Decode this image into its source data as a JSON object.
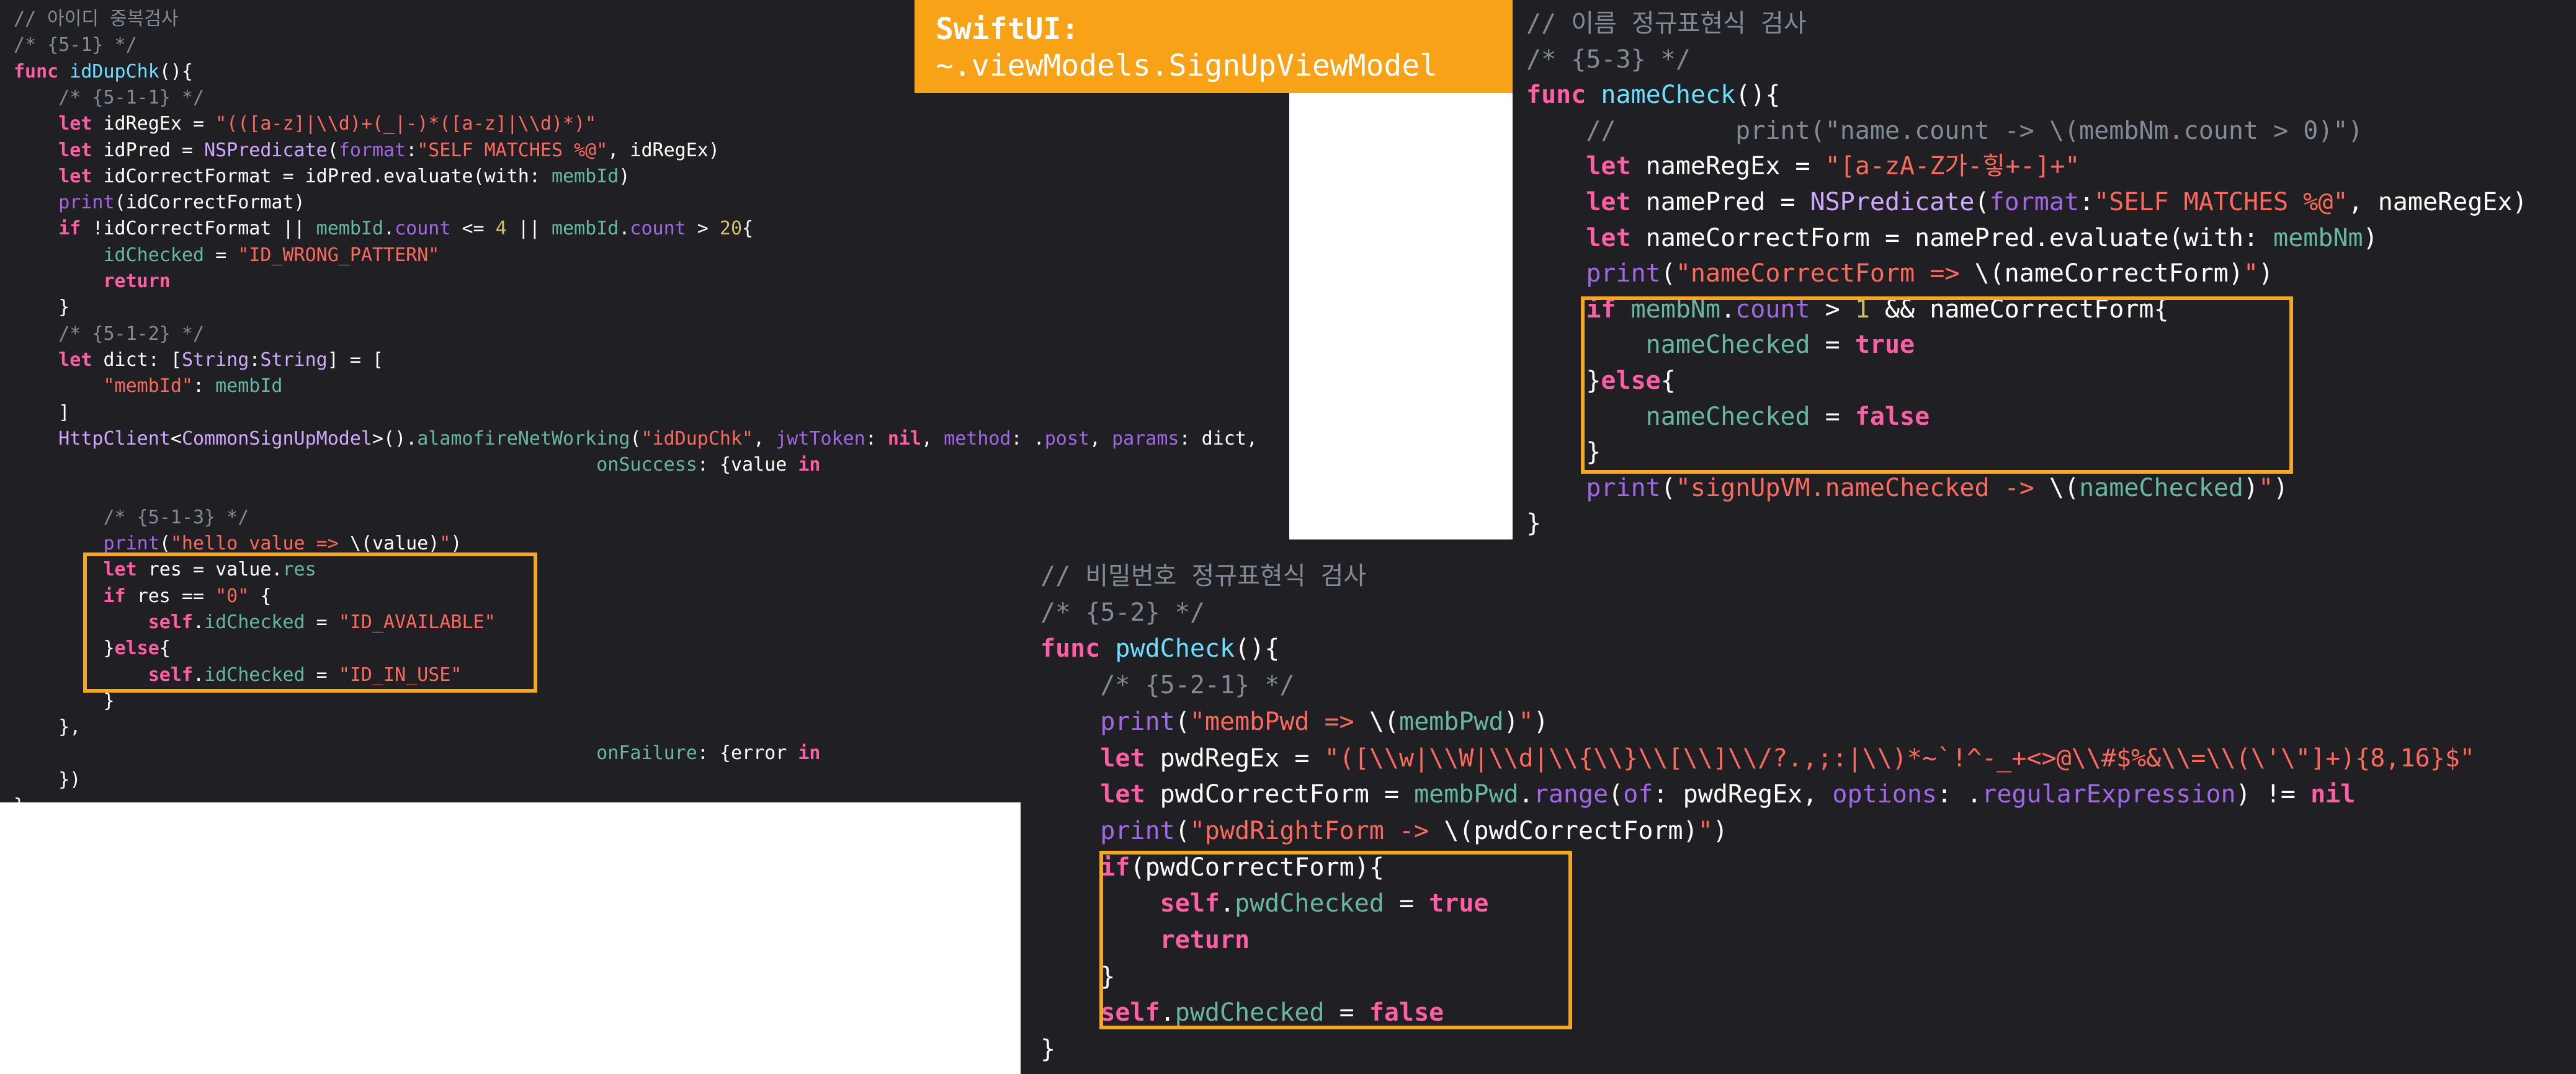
{
  "banner": {
    "line1": "SwiftUI:",
    "line2": "~.viewModels.SignUpViewModel"
  },
  "colors": {
    "background": "#1f1f24",
    "highlight_box": "#f5a623",
    "banner": "#f7a217",
    "comment": "#7f8c98",
    "keyword": "#fc5fa3",
    "string": "#fc6a5d",
    "number": "#d0bf69"
  },
  "panels": {
    "id_check": {
      "lines": [
        [
          [
            "c-comment",
            "// 아이디 중복검사"
          ]
        ],
        [
          [
            "c-comment",
            "/* {5-1} */"
          ]
        ],
        [
          [
            "c-kw",
            "func "
          ],
          [
            "c-call",
            "idDupChk"
          ],
          [
            "c-plain",
            "(){"
          ]
        ],
        [
          [
            "c-plain",
            "    "
          ],
          [
            "c-comment",
            "/* {5-1-1} */"
          ]
        ],
        [
          [
            "c-plain",
            "    "
          ],
          [
            "c-kw",
            "let "
          ],
          [
            "c-plain",
            "idRegEx = "
          ],
          [
            "c-str",
            "\"(([a-z]|\\\\d)+(_|-)*([a-z]|\\\\d)*)\""
          ]
        ],
        [
          [
            "c-plain",
            "    "
          ],
          [
            "c-kw",
            "let "
          ],
          [
            "c-plain",
            "idPred = "
          ],
          [
            "c-type",
            "NSPredicate"
          ],
          [
            "c-plain",
            "("
          ],
          [
            "c-prop",
            "format"
          ],
          [
            "c-plain",
            ":"
          ],
          [
            "c-str",
            "\"SELF MATCHES %@\""
          ],
          [
            "c-plain",
            ", idRegEx)"
          ]
        ],
        [
          [
            "c-plain",
            "    "
          ],
          [
            "c-kw",
            "let "
          ],
          [
            "c-plain",
            "idCorrectFormat = idPred.evaluate(with: "
          ],
          [
            "c-fn",
            "membId"
          ],
          [
            "c-plain",
            ")"
          ]
        ],
        [
          [
            "c-plain",
            "    "
          ],
          [
            "c-prop",
            "print"
          ],
          [
            "c-plain",
            "(idCorrectFormat)"
          ]
        ],
        [
          [
            "c-plain",
            "    "
          ],
          [
            "c-kw",
            "if "
          ],
          [
            "c-plain",
            "!idCorrectFormat || "
          ],
          [
            "c-fn",
            "membId"
          ],
          [
            "c-plain",
            "."
          ],
          [
            "c-prop",
            "count"
          ],
          [
            "c-plain",
            " <= "
          ],
          [
            "c-num",
            "4"
          ],
          [
            "c-plain",
            " || "
          ],
          [
            "c-fn",
            "membId"
          ],
          [
            "c-plain",
            "."
          ],
          [
            "c-prop",
            "count"
          ],
          [
            "c-plain",
            " > "
          ],
          [
            "c-num",
            "20"
          ],
          [
            "c-plain",
            "{"
          ]
        ],
        [
          [
            "c-plain",
            "        "
          ],
          [
            "c-fn",
            "idChecked"
          ],
          [
            "c-plain",
            " = "
          ],
          [
            "c-str",
            "\"ID_WRONG_PATTERN\""
          ]
        ],
        [
          [
            "c-plain",
            "        "
          ],
          [
            "c-kw",
            "return"
          ]
        ],
        [
          [
            "c-plain",
            "    }"
          ]
        ],
        [
          [
            "c-plain",
            "    "
          ],
          [
            "c-comment",
            "/* {5-1-2} */"
          ]
        ],
        [
          [
            "c-plain",
            "    "
          ],
          [
            "c-kw",
            "let "
          ],
          [
            "c-plain",
            "dict: ["
          ],
          [
            "c-type",
            "String"
          ],
          [
            "c-plain",
            ":"
          ],
          [
            "c-type",
            "String"
          ],
          [
            "c-plain",
            "] = ["
          ]
        ],
        [
          [
            "c-plain",
            "        "
          ],
          [
            "c-str",
            "\"membId\""
          ],
          [
            "c-plain",
            ": "
          ],
          [
            "c-fn",
            "membId"
          ]
        ],
        [
          [
            "c-plain",
            "    ]"
          ]
        ],
        [
          [
            "c-plain",
            "    "
          ],
          [
            "c-type",
            "HttpClient"
          ],
          [
            "c-plain",
            "<"
          ],
          [
            "c-type",
            "CommonSignUpModel"
          ],
          [
            "c-plain",
            ">()."
          ],
          [
            "c-fn",
            "alamofireNetWorking"
          ],
          [
            "c-plain",
            "("
          ],
          [
            "c-str",
            "\"idDupChk\""
          ],
          [
            "c-plain",
            ", "
          ],
          [
            "c-prop",
            "jwtToken"
          ],
          [
            "c-plain",
            ": "
          ],
          [
            "c-kw",
            "nil"
          ],
          [
            "c-plain",
            ", "
          ],
          [
            "c-prop",
            "method"
          ],
          [
            "c-plain",
            ": ."
          ],
          [
            "c-prop",
            "post"
          ],
          [
            "c-plain",
            ", "
          ],
          [
            "c-prop",
            "params"
          ],
          [
            "c-plain",
            ": dict,"
          ]
        ],
        [
          [
            "c-plain",
            "                                                    "
          ],
          [
            "c-fn",
            "onSuccess"
          ],
          [
            "c-plain",
            ": {value "
          ],
          [
            "c-kw",
            "in"
          ]
        ],
        [
          [
            "c-plain",
            ""
          ]
        ],
        [
          [
            "c-plain",
            "        "
          ],
          [
            "c-comment",
            "/* {5-1-3} */"
          ]
        ],
        [
          [
            "c-plain",
            "        "
          ],
          [
            "c-prop",
            "print"
          ],
          [
            "c-plain",
            "("
          ],
          [
            "c-str",
            "\"hello value => "
          ],
          [
            "c-plain",
            "\\(value)"
          ],
          [
            "c-str",
            "\""
          ],
          [
            "c-plain",
            ")"
          ]
        ],
        [
          [
            "c-plain",
            "        "
          ],
          [
            "c-kw",
            "let "
          ],
          [
            "c-plain",
            "res = value."
          ],
          [
            "c-fn",
            "res"
          ]
        ],
        [
          [
            "c-plain",
            "        "
          ],
          [
            "c-kw",
            "if "
          ],
          [
            "c-plain",
            "res == "
          ],
          [
            "c-str",
            "\"0\""
          ],
          [
            "c-plain",
            " {"
          ]
        ],
        [
          [
            "c-plain",
            "            "
          ],
          [
            "c-kw",
            "self"
          ],
          [
            "c-plain",
            "."
          ],
          [
            "c-fn",
            "idChecked"
          ],
          [
            "c-plain",
            " = "
          ],
          [
            "c-str",
            "\"ID_AVAILABLE\""
          ]
        ],
        [
          [
            "c-plain",
            "        }"
          ],
          [
            "c-kw",
            "else"
          ],
          [
            "c-plain",
            "{"
          ]
        ],
        [
          [
            "c-plain",
            "            "
          ],
          [
            "c-kw",
            "self"
          ],
          [
            "c-plain",
            "."
          ],
          [
            "c-fn",
            "idChecked"
          ],
          [
            "c-plain",
            " = "
          ],
          [
            "c-str",
            "\"ID_IN_USE\""
          ]
        ],
        [
          [
            "c-plain",
            "        }"
          ]
        ],
        [
          [
            "c-plain",
            "    },"
          ]
        ],
        [
          [
            "c-plain",
            "                                                    "
          ],
          [
            "c-fn",
            "onFailure"
          ],
          [
            "c-plain",
            ": {error "
          ],
          [
            "c-kw",
            "in"
          ]
        ],
        [
          [
            "c-plain",
            "    })"
          ]
        ],
        [
          [
            "c-plain",
            "}"
          ]
        ]
      ]
    },
    "name_check": {
      "lines": [
        [
          [
            "c-comment",
            "// 이름 정규표현식 검사"
          ]
        ],
        [
          [
            "c-comment",
            "/* {5-3} */"
          ]
        ],
        [
          [
            "c-kw",
            "func "
          ],
          [
            "c-call",
            "nameCheck"
          ],
          [
            "c-plain",
            "(){"
          ]
        ],
        [
          [
            "c-plain",
            "    "
          ],
          [
            "c-comment",
            "//        print(\"name.count -> \\(membNm.count > 0)\")"
          ]
        ],
        [
          [
            "c-plain",
            "    "
          ],
          [
            "c-kw",
            "let "
          ],
          [
            "c-plain",
            "nameRegEx = "
          ],
          [
            "c-str",
            "\"[a-zA-Z가-힣+-]+\""
          ]
        ],
        [
          [
            "c-plain",
            "    "
          ],
          [
            "c-kw",
            "let "
          ],
          [
            "c-plain",
            "namePred = "
          ],
          [
            "c-type",
            "NSPredicate"
          ],
          [
            "c-plain",
            "("
          ],
          [
            "c-prop",
            "format"
          ],
          [
            "c-plain",
            ":"
          ],
          [
            "c-str",
            "\"SELF MATCHES %@\""
          ],
          [
            "c-plain",
            ", nameRegEx)"
          ]
        ],
        [
          [
            "c-plain",
            "    "
          ],
          [
            "c-kw",
            "let "
          ],
          [
            "c-plain",
            "nameCorrectForm = namePred.evaluate(with: "
          ],
          [
            "c-fn",
            "membNm"
          ],
          [
            "c-plain",
            ")"
          ]
        ],
        [
          [
            "c-plain",
            "    "
          ],
          [
            "c-prop",
            "print"
          ],
          [
            "c-plain",
            "("
          ],
          [
            "c-str",
            "\"nameCorrectForm => "
          ],
          [
            "c-plain",
            "\\(nameCorrectForm)"
          ],
          [
            "c-str",
            "\""
          ],
          [
            "c-plain",
            ")"
          ]
        ],
        [
          [
            "c-plain",
            "    "
          ],
          [
            "c-kw",
            "if "
          ],
          [
            "c-fn",
            "membNm"
          ],
          [
            "c-plain",
            "."
          ],
          [
            "c-prop",
            "count"
          ],
          [
            "c-plain",
            " > "
          ],
          [
            "c-num",
            "1"
          ],
          [
            "c-plain",
            " && nameCorrectForm{"
          ]
        ],
        [
          [
            "c-plain",
            "        "
          ],
          [
            "c-fn",
            "nameChecked"
          ],
          [
            "c-plain",
            " = "
          ],
          [
            "c-kw",
            "true"
          ]
        ],
        [
          [
            "c-plain",
            "    }"
          ],
          [
            "c-kw",
            "else"
          ],
          [
            "c-plain",
            "{"
          ]
        ],
        [
          [
            "c-plain",
            "        "
          ],
          [
            "c-fn",
            "nameChecked"
          ],
          [
            "c-plain",
            " = "
          ],
          [
            "c-kw",
            "false"
          ]
        ],
        [
          [
            "c-plain",
            "    }"
          ]
        ],
        [
          [
            "c-plain",
            "    "
          ],
          [
            "c-prop",
            "print"
          ],
          [
            "c-plain",
            "("
          ],
          [
            "c-str",
            "\"signUpVM.nameChecked -> "
          ],
          [
            "c-plain",
            "\\("
          ],
          [
            "c-fn",
            "nameChecked"
          ],
          [
            "c-plain",
            ")"
          ],
          [
            "c-str",
            "\""
          ],
          [
            "c-plain",
            ")"
          ]
        ],
        [
          [
            "c-plain",
            "}"
          ]
        ]
      ]
    },
    "pwd_check": {
      "lines": [
        [
          [
            "c-comment",
            "// 비밀번호 정규표현식 검사"
          ]
        ],
        [
          [
            "c-comment",
            "/* {5-2} */"
          ]
        ],
        [
          [
            "c-kw",
            "func "
          ],
          [
            "c-call",
            "pwdCheck"
          ],
          [
            "c-plain",
            "(){"
          ]
        ],
        [
          [
            "c-plain",
            "    "
          ],
          [
            "c-comment",
            "/* {5-2-1} */"
          ]
        ],
        [
          [
            "c-plain",
            "    "
          ],
          [
            "c-prop",
            "print"
          ],
          [
            "c-plain",
            "("
          ],
          [
            "c-str",
            "\"membPwd => "
          ],
          [
            "c-plain",
            "\\("
          ],
          [
            "c-fn",
            "membPwd"
          ],
          [
            "c-plain",
            ")"
          ],
          [
            "c-str",
            "\""
          ],
          [
            "c-plain",
            ")"
          ]
        ],
        [
          [
            "c-plain",
            "    "
          ],
          [
            "c-kw",
            "let "
          ],
          [
            "c-plain",
            "pwdRegEx = "
          ],
          [
            "c-str",
            "\"([\\\\w|\\\\W|\\\\d|\\\\{\\\\}\\\\[\\\\]\\\\/?.,;:|\\\\)*~`!^-_+<>@\\\\#$%&\\\\=\\\\(\\'\\\"]+){8,16}$\""
          ]
        ],
        [
          [
            "c-plain",
            "    "
          ],
          [
            "c-kw",
            "let "
          ],
          [
            "c-plain",
            "pwdCorrectForm = "
          ],
          [
            "c-fn",
            "membPwd"
          ],
          [
            "c-plain",
            "."
          ],
          [
            "c-prop",
            "range"
          ],
          [
            "c-plain",
            "("
          ],
          [
            "c-prop",
            "of"
          ],
          [
            "c-plain",
            ": pwdRegEx, "
          ],
          [
            "c-prop",
            "options"
          ],
          [
            "c-plain",
            ": ."
          ],
          [
            "c-prop",
            "regularExpression"
          ],
          [
            "c-plain",
            ") != "
          ],
          [
            "c-kw",
            "nil"
          ]
        ],
        [
          [
            "c-plain",
            "    "
          ],
          [
            "c-prop",
            "print"
          ],
          [
            "c-plain",
            "("
          ],
          [
            "c-str",
            "\"pwdRightForm -> "
          ],
          [
            "c-plain",
            "\\(pwdCorrectForm)"
          ],
          [
            "c-str",
            "\""
          ],
          [
            "c-plain",
            ")"
          ]
        ],
        [
          [
            "c-plain",
            "    "
          ],
          [
            "c-kw",
            "if"
          ],
          [
            "c-plain",
            "(pwdCorrectForm){"
          ]
        ],
        [
          [
            "c-plain",
            "        "
          ],
          [
            "c-kw",
            "self"
          ],
          [
            "c-plain",
            "."
          ],
          [
            "c-fn",
            "pwdChecked"
          ],
          [
            "c-plain",
            " = "
          ],
          [
            "c-kw",
            "true"
          ]
        ],
        [
          [
            "c-plain",
            "        "
          ],
          [
            "c-kw",
            "return"
          ]
        ],
        [
          [
            "c-plain",
            "    }"
          ]
        ],
        [
          [
            "c-plain",
            "    "
          ],
          [
            "c-kw",
            "self"
          ],
          [
            "c-plain",
            "."
          ],
          [
            "c-fn",
            "pwdChecked"
          ],
          [
            "c-plain",
            " = "
          ],
          [
            "c-kw",
            "false"
          ]
        ],
        [
          [
            "c-plain",
            "}"
          ]
        ]
      ]
    }
  }
}
